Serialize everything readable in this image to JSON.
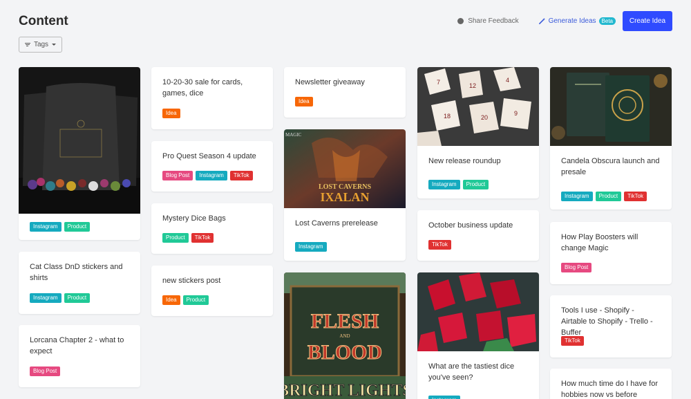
{
  "page": {
    "title": "Content"
  },
  "header": {
    "share_feedback": "Share Feedback",
    "generate_ideas": "Generate Ideas",
    "beta": "Beta",
    "create_idea": "Create Idea"
  },
  "filters": {
    "tags_label": "Tags"
  },
  "tag_colors": {
    "Idea": "#f76707",
    "Instagram": "#15aabf",
    "Product": "#20c997",
    "Blog Post": "#e64980",
    "TikTok": "#e03131"
  },
  "cards": {
    "c1": {
      "tags": [
        "Instagram",
        "Product"
      ],
      "image": "mystery-dice-bags-photo"
    },
    "c2": {
      "title": "Cat Class DnD stickers and shirts",
      "tags": [
        "Instagram",
        "Product"
      ]
    },
    "c3": {
      "title": "Lorcana Chapter 2 - what to expect",
      "tags": [
        "Blog Post"
      ]
    },
    "c4": {
      "title": "10-20-30 sale for cards, games, dice",
      "tags": [
        "Idea"
      ]
    },
    "c5": {
      "title": "Pro Quest Season 4 update",
      "tags": [
        "Blog Post",
        "Instagram",
        "TikTok"
      ]
    },
    "c6": {
      "title": "Mystery Dice Bags",
      "tags": [
        "Product",
        "TikTok"
      ]
    },
    "c7": {
      "title": "new stickers post",
      "tags": [
        "Idea",
        "Product"
      ]
    },
    "c8": {
      "title": "Newsletter giveaway",
      "tags": [
        "Idea"
      ]
    },
    "c9": {
      "title": "Lost Caverns prerelease",
      "tags": [
        "Instagram"
      ],
      "image_text": [
        "MAGIC",
        "LOST CAVERNS",
        "IXALAN"
      ]
    },
    "c10": {
      "image_text": [
        "FLESH",
        "AND",
        "BLOOD",
        "BRIGHT LIGHTS"
      ]
    },
    "c11": {
      "title": "New release roundup",
      "tags": [
        "Instagram",
        "Product"
      ],
      "image": "white-dice-photo"
    },
    "c12": {
      "title": "October business update",
      "tags": [
        "TikTok"
      ]
    },
    "c13": {
      "title": "What are the tastiest dice you've seen?",
      "tags": [
        "Instagram"
      ],
      "image": "red-dice-photo"
    },
    "c14": {
      "title": "Candela Obscura launch and presale",
      "tags": [
        "Instagram",
        "Product",
        "TikTok"
      ],
      "image": "candela-obscura-books-photo"
    },
    "c15": {
      "title": "How Play Boosters will change Magic",
      "tags": [
        "Blog Post"
      ]
    },
    "c16": {
      "title": "Tools I use - Shopify - Airtable to Shopify - Trello - Buffer",
      "tags": [
        "TikTok"
      ]
    },
    "c17": {
      "title": "How much time do I have for hobbies now vs before"
    }
  }
}
